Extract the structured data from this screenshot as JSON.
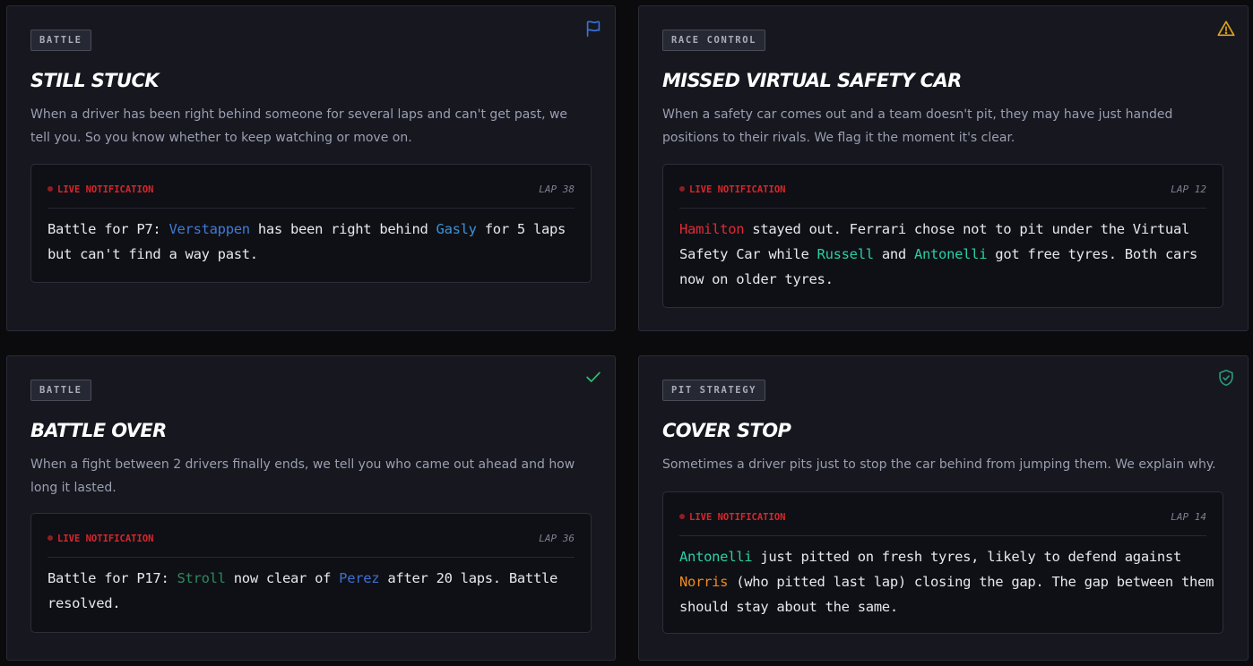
{
  "cards": [
    {
      "tag": "BATTLE",
      "title": "STILL STUCK",
      "description": "When a driver has been right behind someone for several laps and can't get past, we tell you. So you know whether to keep watching or move on.",
      "icon": "flag-icon",
      "icon_color": "#3b73d9",
      "notification": {
        "label": "LIVE NOTIFICATION",
        "lap": "LAP 38",
        "segments": [
          {
            "text": "Battle for P7: "
          },
          {
            "text": "Verstappen",
            "color": "#3e7ad6"
          },
          {
            "text": " has been right behind "
          },
          {
            "text": "Gasly",
            "color": "#3b93d8"
          },
          {
            "text": " for 5 laps but can't find a way past."
          }
        ]
      }
    },
    {
      "tag": "RACE CONTROL",
      "title": "MISSED VIRTUAL SAFETY CAR",
      "description": "When a safety car comes out and a team doesn't pit, they may have just handed positions to their rivals. We flag it the moment it's clear.",
      "icon": "warning-icon",
      "icon_color": "#e0a41a",
      "notification": {
        "label": "LIVE NOTIFICATION",
        "lap": "LAP 12",
        "segments": [
          {
            "text": "Hamilton",
            "color": "#e02a36"
          },
          {
            "text": " stayed out. Ferrari chose not to pit under the Virtual Safety Car while "
          },
          {
            "text": "Russell",
            "color": "#29cfa6"
          },
          {
            "text": " and "
          },
          {
            "text": "Antonelli",
            "color": "#29cfa6"
          },
          {
            "text": " got free tyres. Both cars now on older tyres."
          }
        ]
      }
    },
    {
      "tag": "BATTLE",
      "title": "BATTLE OVER",
      "description": "When a fight between 2 drivers finally ends, we tell you who came out ahead and how long it lasted.",
      "icon": "checkmark-icon",
      "icon_color": "#2fbf71",
      "notification": {
        "label": "LIVE NOTIFICATION",
        "lap": "LAP 36",
        "segments": [
          {
            "text": "Battle for P17: "
          },
          {
            "text": "Stroll",
            "color": "#2d8a5e"
          },
          {
            "text": " now clear of "
          },
          {
            "text": "Perez",
            "color": "#3e6fd0"
          },
          {
            "text": " after 20 laps. Battle resolved."
          }
        ]
      }
    },
    {
      "tag": "PIT STRATEGY",
      "title": "COVER STOP",
      "description": "Sometimes a driver pits just to stop the car behind from jumping them. We explain why.",
      "icon": "shield-check-icon",
      "icon_color": "#2a9a78",
      "notification": {
        "label": "LIVE NOTIFICATION",
        "lap": "LAP 14",
        "segments": [
          {
            "text": "Antonelli",
            "color": "#29cfa6"
          },
          {
            "text": " just pitted on fresh tyres, likely to defend against "
          },
          {
            "text": "Norris",
            "color": "#f28a1e"
          },
          {
            "text": " (who pitted last lap) closing the gap. The gap between them should stay about the same."
          }
        ]
      }
    }
  ]
}
